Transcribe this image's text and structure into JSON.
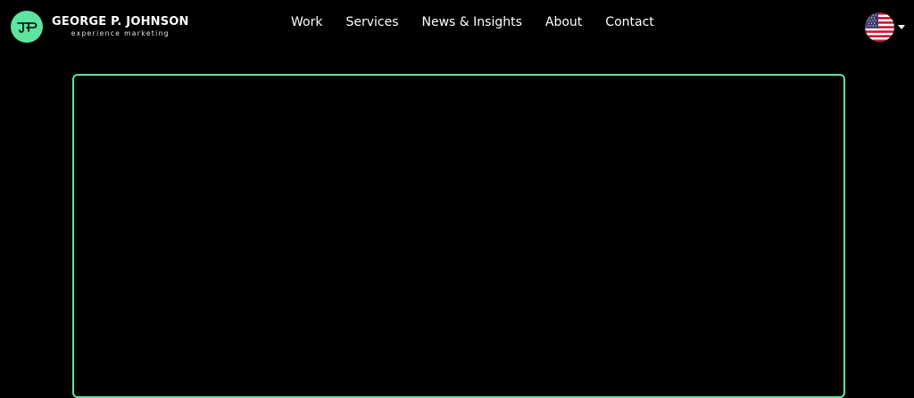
{
  "brand": {
    "name": "GEORGE P. JOHNSON",
    "tagline": "experience marketing",
    "logo_icon": "gpj-logo-icon",
    "accent_color": "#5fe3a1"
  },
  "nav": {
    "items": [
      {
        "label": "Work"
      },
      {
        "label": "Services"
      },
      {
        "label": "News & Insights"
      },
      {
        "label": "About"
      },
      {
        "label": "Contact"
      }
    ]
  },
  "language": {
    "flag_icon": "us-flag-icon",
    "dropdown_icon": "caret-down-icon"
  },
  "colors": {
    "background": "#000000",
    "text": "#ffffff",
    "frame_border": "#5fe3a1"
  }
}
